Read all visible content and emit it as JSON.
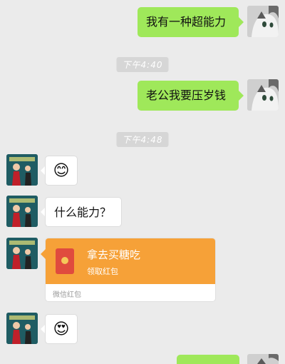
{
  "messages": {
    "m1": "我有一种超能力",
    "t1": "下午4:40",
    "m2": "老公我要压岁钱",
    "t2": "下午4:48",
    "m3": "😊",
    "m4": "什么能力？",
    "m5": "😍"
  },
  "red_packet": {
    "title": "拿去买糖吃",
    "subtitle": "领取红包",
    "footer": "微信红包"
  },
  "colors": {
    "sent_bubble": "#9fe85a",
    "received_bubble": "#ffffff",
    "red_packet": "#f6a138",
    "background": "#ebebeb"
  }
}
